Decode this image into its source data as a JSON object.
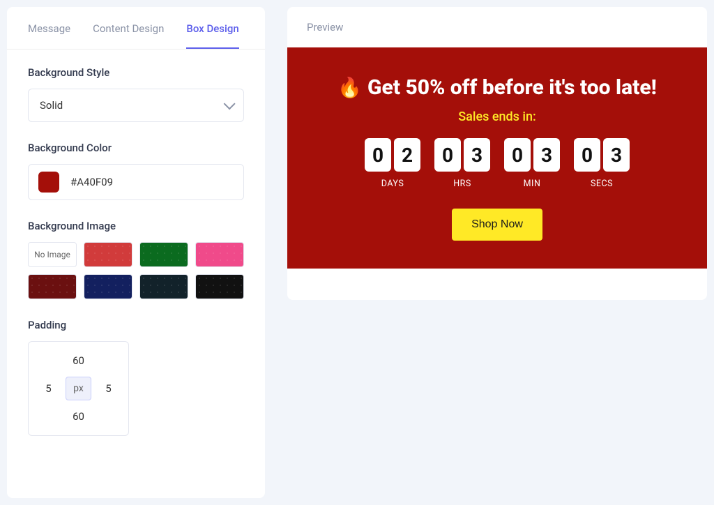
{
  "tabs": {
    "message": "Message",
    "content_design": "Content Design",
    "box_design": "Box Design"
  },
  "background_style": {
    "label": "Background Style",
    "value": "Solid"
  },
  "background_color": {
    "label": "Background Color",
    "hex": "#A40F09"
  },
  "background_image": {
    "label": "Background Image",
    "no_image": "No Image"
  },
  "padding": {
    "label": "Padding",
    "top": "60",
    "right": "5",
    "bottom": "60",
    "left": "5",
    "unit": "px"
  },
  "preview": {
    "label": "Preview",
    "headline": "Get 50% off before it's too late!",
    "subline": "Sales ends in:",
    "cta_label": "Shop Now",
    "countdown": {
      "days": {
        "d1": "0",
        "d2": "2",
        "label": "DAYS"
      },
      "hrs": {
        "d1": "0",
        "d2": "3",
        "label": "HRS"
      },
      "min": {
        "d1": "0",
        "d2": "3",
        "label": "MIN"
      },
      "secs": {
        "d1": "0",
        "d2": "3",
        "label": "SECS"
      }
    }
  }
}
